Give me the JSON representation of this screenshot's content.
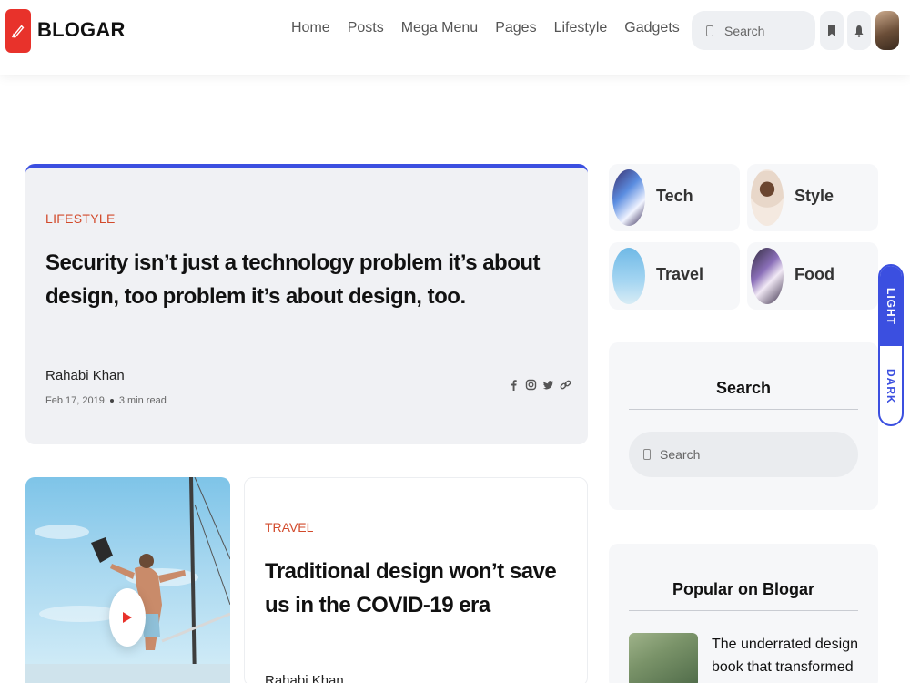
{
  "brand": {
    "name": "BLOGAR",
    "accent": "#e8322b"
  },
  "nav": [
    "Home",
    "Posts",
    "Mega Menu",
    "Pages",
    "Lifestyle",
    "Gadgets"
  ],
  "header": {
    "search_placeholder": "Search"
  },
  "icons": {
    "bookmark": "bookmark-icon",
    "bell": "bell-icon",
    "logo": "pen-icon"
  },
  "featured": {
    "category": "LIFESTYLE",
    "title": "Security isn’t just a technology problem it’s about design, too problem it’s about design, too.",
    "author": "Rahabi Khan",
    "date": "Feb 17, 2019",
    "read_time": "3 min read",
    "socials": [
      "facebook-icon",
      "instagram-icon",
      "twitter-icon",
      "link-icon"
    ],
    "accent": "#3b4fe0"
  },
  "post2": {
    "category": "TRAVEL",
    "title": "Traditional design won’t save us in the COVID-19 era",
    "author": "Rahabi Khan"
  },
  "categories": [
    {
      "name": "Tech"
    },
    {
      "name": "Style"
    },
    {
      "name": "Travel"
    },
    {
      "name": "Food"
    }
  ],
  "sidebar": {
    "search_heading": "Search",
    "search_placeholder": "Search",
    "popular_heading": "Popular on Blogar",
    "popular_item": "The underrated design book that transformed the way I"
  },
  "theme_toggle": {
    "light": "LIGHT",
    "dark": "DARK"
  }
}
